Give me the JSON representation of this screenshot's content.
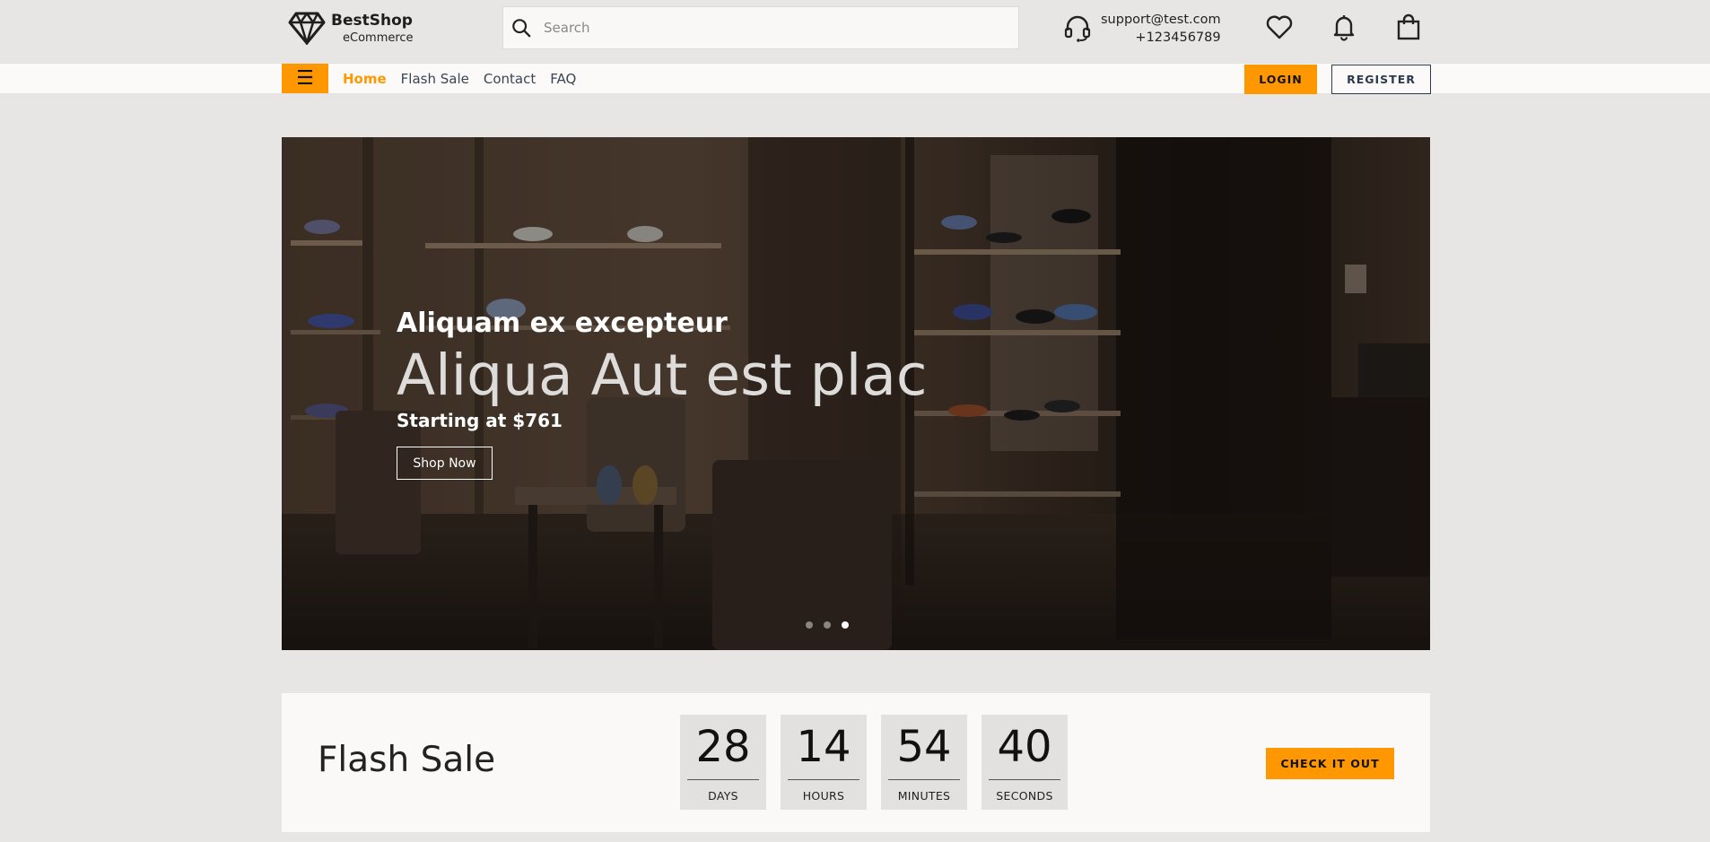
{
  "brand": {
    "name": "BestShop",
    "tagline": "eCommerce"
  },
  "search": {
    "placeholder": "Search",
    "value": ""
  },
  "support": {
    "email": "support@test.com",
    "phone": "+123456789"
  },
  "nav": {
    "links": [
      {
        "label": "Home",
        "active": true
      },
      {
        "label": "Flash Sale",
        "active": false
      },
      {
        "label": "Contact",
        "active": false
      },
      {
        "label": "FAQ",
        "active": false
      }
    ],
    "login_label": "LOGIN",
    "register_label": "REGISTER"
  },
  "hero": {
    "kicker": "Aliquam ex excepteur",
    "title": "Aliqua Aut est plac",
    "price": "Starting at $761",
    "button_label": "Shop Now",
    "slides_count": 3,
    "active_slide": 3
  },
  "flash_sale": {
    "title": "Flash Sale",
    "countdown": [
      {
        "value": "28",
        "label": "DAYS"
      },
      {
        "value": "14",
        "label": "HOURS"
      },
      {
        "value": "54",
        "label": "MINUTES"
      },
      {
        "value": "40",
        "label": "SECONDS"
      }
    ],
    "button_label": "CHECK IT OUT"
  },
  "colors": {
    "accent": "#ff9800",
    "page_bg": "#e7e6e4",
    "nav_text": "#3a4453",
    "register_border": "#2c3a4f"
  },
  "icons": {
    "logo": "diamond-logo-icon",
    "search": "search-icon",
    "support": "headset-icon",
    "wishlist": "heart-icon",
    "notifications": "bell-icon",
    "cart": "shopping-bag-icon",
    "menu": "hamburger-icon"
  }
}
